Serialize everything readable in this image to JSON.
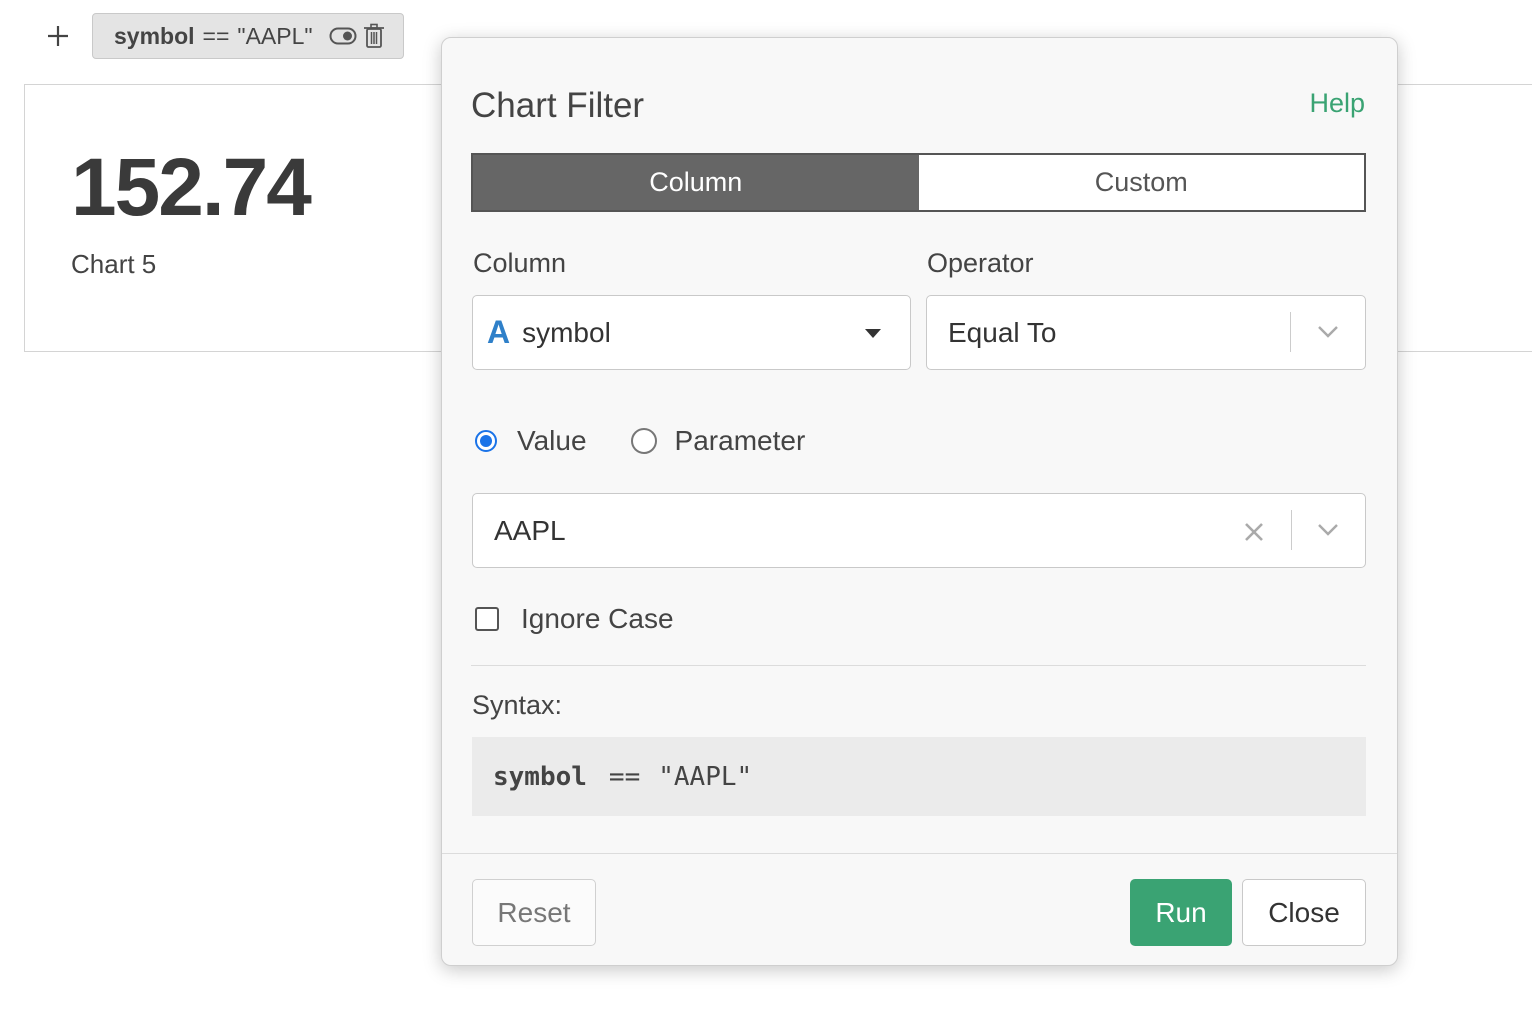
{
  "toolbar": {
    "add_icon": "plus-icon",
    "filter_chip": {
      "field": "symbol",
      "operator": "==",
      "value": "\"AAPL\"",
      "icons": [
        "toggle-icon",
        "trash-icon"
      ]
    }
  },
  "chart": {
    "value": "152.74",
    "name": "Chart 5"
  },
  "dialog": {
    "title": "Chart Filter",
    "help_label": "Help",
    "tabs": [
      {
        "label": "Column",
        "active": true
      },
      {
        "label": "Custom",
        "active": false
      }
    ],
    "column_label": "Column",
    "column_value": "symbol",
    "column_type_icon": "A",
    "operator_label": "Operator",
    "operator_value": "Equal To",
    "mode_options": [
      {
        "label": "Value",
        "checked": true
      },
      {
        "label": "Parameter",
        "checked": false
      }
    ],
    "value_input": "AAPL",
    "ignore_case_label": "Ignore Case",
    "ignore_case_checked": false,
    "syntax_label": "Syntax:",
    "syntax": {
      "field": "symbol",
      "operator": "==",
      "value": "\"AAPL\""
    },
    "buttons": {
      "reset": "Reset",
      "run": "Run",
      "close": "Close"
    }
  },
  "colors": {
    "accent_green": "#3aa373",
    "radio_blue": "#1a73e8",
    "tab_active": "#666666",
    "type_icon_blue": "#2f80c9"
  }
}
